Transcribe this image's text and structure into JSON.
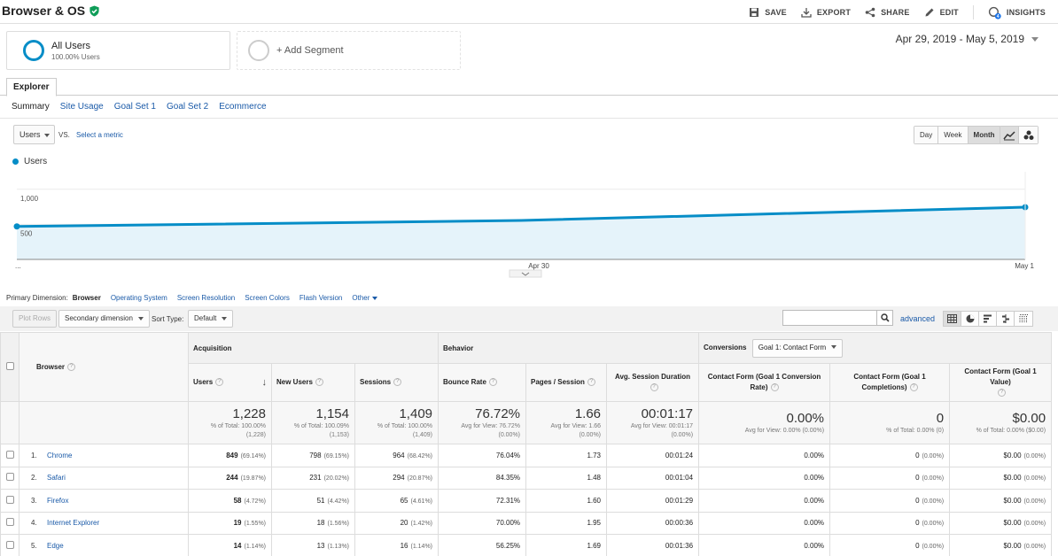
{
  "header": {
    "title": "Browser & OS",
    "actions": {
      "save": "SAVE",
      "export": "EXPORT",
      "share": "SHARE",
      "edit": "EDIT",
      "insights": "INSIGHTS",
      "insights_badge": "4"
    }
  },
  "segments": {
    "all_users": {
      "name": "All Users",
      "sub": "100.00% Users"
    },
    "add": "+ Add Segment"
  },
  "date_range": "Apr 29, 2019 - May 5, 2019",
  "tabs": {
    "explorer": "Explorer"
  },
  "subtabs": [
    "Summary",
    "Site Usage",
    "Goal Set 1",
    "Goal Set 2",
    "Ecommerce"
  ],
  "metric": {
    "selected": "Users",
    "vs": "VS.",
    "select_metric": "Select a metric"
  },
  "granularity": [
    "Day",
    "Week",
    "Month"
  ],
  "chart_data": {
    "type": "area",
    "series": [
      {
        "name": "Users",
        "values": [
          470,
          555,
          745
        ]
      }
    ],
    "x": [
      "...",
      "Apr 30",
      "May 1"
    ],
    "y_ticks": [
      "500",
      "1,000"
    ],
    "ylim": [
      0,
      1250
    ],
    "color": "#058dc7",
    "fill": "#e5f3fa",
    "legend": "top-left",
    "grid": true
  },
  "primary_dimension": {
    "label": "Primary Dimension:",
    "items": [
      "Browser",
      "Operating System",
      "Screen Resolution",
      "Screen Colors",
      "Flash Version",
      "Other"
    ]
  },
  "controls": {
    "plot_rows": "Plot Rows",
    "secondary_dimension": "Secondary dimension",
    "sort_type_label": "Sort Type:",
    "sort_type_value": "Default",
    "search_value": "",
    "advanced": "advanced"
  },
  "table": {
    "groups": {
      "acquisition": "Acquisition",
      "behavior": "Behavior",
      "conversions": "Conversions",
      "goal_select": "Goal 1: Contact Form"
    },
    "columns": {
      "browser": "Browser",
      "users": "Users",
      "new_users": "New Users",
      "sessions": "Sessions",
      "bounce_rate": "Bounce Rate",
      "pages_session": "Pages / Session",
      "avg_duration": "Avg. Session Duration",
      "conv_rate": "Contact Form (Goal 1 Conversion Rate)",
      "completions": "Contact Form (Goal 1 Completions)",
      "value": "Contact Form (Goal 1 Value)"
    },
    "totals": {
      "users": {
        "v": "1,228",
        "s1": "% of Total: 100.00%",
        "s2": "(1,228)"
      },
      "new_users": {
        "v": "1,154",
        "s1": "% of Total: 100.09%",
        "s2": "(1,153)"
      },
      "sessions": {
        "v": "1,409",
        "s1": "% of Total: 100.00%",
        "s2": "(1,409)"
      },
      "bounce_rate": {
        "v": "76.72%",
        "s1": "Avg for View: 76.72%",
        "s2": "(0.00%)"
      },
      "pages_session": {
        "v": "1.66",
        "s1": "Avg for View: 1.66",
        "s2": "(0.00%)"
      },
      "avg_duration": {
        "v": "00:01:17",
        "s1": "Avg for View: 00:01:17",
        "s2": "(0.00%)"
      },
      "conv_rate": {
        "v": "0.00%",
        "s1": "Avg for View: 0.00% (0.00%)"
      },
      "completions": {
        "v": "0",
        "s1": "% of Total: 0.00% (0)"
      },
      "value": {
        "v": "$0.00",
        "s1": "% of Total: 0.00% ($0.00)"
      }
    },
    "rows": [
      {
        "idx": "1.",
        "browser": "Chrome",
        "users": "849",
        "users_pct": "(69.14%)",
        "new_users": "798",
        "new_users_pct": "(69.15%)",
        "sessions": "964",
        "sessions_pct": "(68.42%)",
        "bounce": "76.04%",
        "pages": "1.73",
        "duration": "00:01:24",
        "conv": "0.00%",
        "comp": "0",
        "comp_pct": "(0.00%)",
        "value": "$0.00",
        "value_pct": "(0.00%)"
      },
      {
        "idx": "2.",
        "browser": "Safari",
        "users": "244",
        "users_pct": "(19.87%)",
        "new_users": "231",
        "new_users_pct": "(20.02%)",
        "sessions": "294",
        "sessions_pct": "(20.87%)",
        "bounce": "84.35%",
        "pages": "1.48",
        "duration": "00:01:04",
        "conv": "0.00%",
        "comp": "0",
        "comp_pct": "(0.00%)",
        "value": "$0.00",
        "value_pct": "(0.00%)"
      },
      {
        "idx": "3.",
        "browser": "Firefox",
        "users": "58",
        "users_pct": "(4.72%)",
        "new_users": "51",
        "new_users_pct": "(4.42%)",
        "sessions": "65",
        "sessions_pct": "(4.61%)",
        "bounce": "72.31%",
        "pages": "1.60",
        "duration": "00:01:29",
        "conv": "0.00%",
        "comp": "0",
        "comp_pct": "(0.00%)",
        "value": "$0.00",
        "value_pct": "(0.00%)"
      },
      {
        "idx": "4.",
        "browser": "Internet Explorer",
        "users": "19",
        "users_pct": "(1.55%)",
        "new_users": "18",
        "new_users_pct": "(1.56%)",
        "sessions": "20",
        "sessions_pct": "(1.42%)",
        "bounce": "70.00%",
        "pages": "1.95",
        "duration": "00:00:36",
        "conv": "0.00%",
        "comp": "0",
        "comp_pct": "(0.00%)",
        "value": "$0.00",
        "value_pct": "(0.00%)"
      },
      {
        "idx": "5.",
        "browser": "Edge",
        "users": "14",
        "users_pct": "(1.14%)",
        "new_users": "13",
        "new_users_pct": "(1.13%)",
        "sessions": "16",
        "sessions_pct": "(1.14%)",
        "bounce": "56.25%",
        "pages": "1.69",
        "duration": "00:01:36",
        "conv": "0.00%",
        "comp": "0",
        "comp_pct": "(0.00%)",
        "value": "$0.00",
        "value_pct": "(0.00%)"
      }
    ]
  }
}
